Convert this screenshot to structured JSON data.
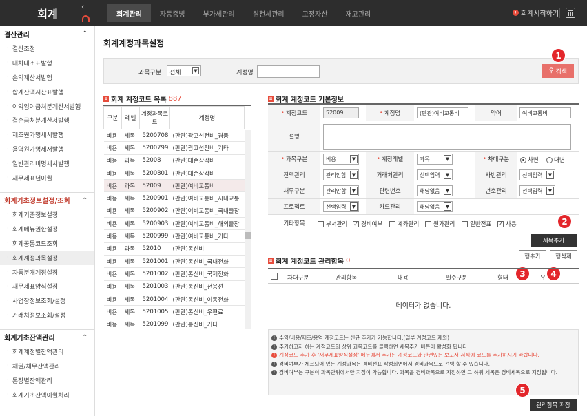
{
  "app": {
    "logo": "회계",
    "collapse_icon": "‹"
  },
  "topnav": {
    "tabs": [
      "회계관리",
      "자동증빙",
      "부가세관리",
      "원천세관리",
      "고정자산",
      "재고관리"
    ],
    "active": 0,
    "start_link": "회계시작하기"
  },
  "sidebar": {
    "sections": [
      {
        "title": "결산관리",
        "items": [
          "결산조정",
          "대차대조표발행",
          "손익계산서발행",
          "합계잔액시산표발행",
          "이익잉여금처분계산서발행",
          "결손금처분계산서발행",
          "제조원가명세서발행",
          "용역원가명세서발행",
          "일반관리비명세서발행",
          "재무제표년이월"
        ]
      },
      {
        "title": "회계기초정보설정/조회",
        "items": [
          "회계기준정보설정",
          "회계메뉴권한설정",
          "회계공통코드조회",
          "회계계정과목설정",
          "자동분개계정설정",
          "재무제표양식설정",
          "사업장정보조회/설정",
          "거래처정보조회/설정"
        ]
      },
      {
        "title": "회계기초잔액관리",
        "items": [
          "회계계정별잔액관리",
          "채권/채무잔액관리",
          "통장별잔액관리",
          "회계기초잔액이월처리"
        ]
      }
    ]
  },
  "page": {
    "title": "회계계정과목설정"
  },
  "filter": {
    "type_label": "과목구분",
    "type_value": "전체",
    "name_label": "계정명",
    "name_value": "",
    "search_label": "검색"
  },
  "list": {
    "title": "회계 계정코드 목록",
    "count": "887",
    "headers": [
      "구분",
      "레벨",
      "계정과목코드",
      "계정명"
    ],
    "rows": [
      [
        "비용",
        "세목",
        "5200708",
        "(판관)광고선전비_경품"
      ],
      [
        "비용",
        "세목",
        "5200799",
        "(판관)광고선전비_기타"
      ],
      [
        "비용",
        "과목",
        "52008",
        "(판관)대손상각비"
      ],
      [
        "비용",
        "세목",
        "5200801",
        "(판관)대손상각비"
      ],
      [
        "비용",
        "과목",
        "52009",
        "(판관)여비교통비"
      ],
      [
        "비용",
        "세목",
        "5200901",
        "(판관)여비교통비_시내교통"
      ],
      [
        "비용",
        "세목",
        "5200902",
        "(판관)여비교통비_국내출장"
      ],
      [
        "비용",
        "세목",
        "5200903",
        "(판관)여비교통비_해외출장"
      ],
      [
        "비용",
        "세목",
        "5200999",
        "(판관)여비교통비_기타"
      ],
      [
        "비용",
        "과목",
        "52010",
        "(판관)통신비"
      ],
      [
        "비용",
        "세목",
        "5201001",
        "(판관)통신비_국내전화"
      ],
      [
        "비용",
        "세목",
        "5201002",
        "(판관)통신비_국제전화"
      ],
      [
        "비용",
        "세목",
        "5201003",
        "(판관)통신비_전용선"
      ],
      [
        "비용",
        "세목",
        "5201004",
        "(판관)통신비_이동전화"
      ],
      [
        "비용",
        "세목",
        "5201005",
        "(판관)통신비_우편료"
      ],
      [
        "비용",
        "세목",
        "5201099",
        "(판관)통신비_기타"
      ]
    ],
    "selected_row": 4
  },
  "detail": {
    "title": "회계 계정코드 기본정보",
    "code_label": "계정코드",
    "code_value": "52009",
    "name_label": "계정명",
    "name_value": "(판관)여비교통비",
    "abbr_label": "약어",
    "abbr_value": "여비교통비",
    "desc_label": "설명",
    "type_label": "과목구분",
    "type_value": "비용",
    "level_label": "계정레벨",
    "level_value": "과목",
    "dc_label": "차대구분",
    "dc_debit": "차변",
    "dc_credit": "대변",
    "balance_label": "잔액관리",
    "balance_value": "관리안함",
    "partner_label": "거래처관리",
    "partner_value": "선택입력",
    "employee_label": "사번관리",
    "employee_value": "선택입력",
    "debt_label": "채무구분",
    "debt_value": "관리안함",
    "relno_label": "관련번호",
    "relno_value": "해당없음",
    "number_label": "번호관리",
    "number_value": "선택입력",
    "project_label": "프로젝트",
    "project_value": "선택입력",
    "card_label": "카드관리",
    "card_value": "해당없음",
    "etc_label": "기타항목",
    "checks": [
      {
        "label": "부서관리",
        "checked": false
      },
      {
        "label": "경비여부",
        "checked": true
      },
      {
        "label": "계좌관리",
        "checked": false
      },
      {
        "label": "원가관리",
        "checked": false
      },
      {
        "label": "일반전표",
        "checked": false
      },
      {
        "label": "사용",
        "checked": true
      }
    ],
    "add_sub_label": "세목추가"
  },
  "manage": {
    "title": "회계 계정코드 관리항목",
    "count": "0",
    "add_row_label": "행추가",
    "del_row_label": "행삭제",
    "headers": [
      "차대구분",
      "관리항목",
      "내용",
      "필수구분",
      "형태",
      "유"
    ],
    "empty": "데이터가 없습니다."
  },
  "notes": [
    "수익/비용/제조/용역 계정코드는 신규 추가가 가능합니다.(일부 계정코드 제외)",
    "추가하고자 하는 계정코드의 상위 과목코드를 클릭하면 세목추가 버튼이 활성화 됩니다.",
    "계정코드 추가 후 '재무제표양식설정' 메뉴에서 추가된 계정코드와 관련있는 보고서 서식에 코드를 추가하시기 바랍니다.",
    "경비여부가 체크되어 있는 계정과목은 경비전표 작성화면에서 경비과목으로 선택 할 수 있습니다.",
    "경비여부는 구분이 과목단위에서만 지정이 가능합니다. 과목을 경비과목으로 지정하면 그 하위 세목은 경비세목으로 지정됩니다."
  ],
  "red_note_index": 2,
  "save_label": "관리항목 저장",
  "badges": [
    "1",
    "2",
    "3",
    "4",
    "5"
  ],
  "colors": {
    "accent_red": "#e74c3c",
    "badge_red": "#e3262b",
    "search_btn": "#e8706a",
    "topbar": "#2d2d2d"
  }
}
